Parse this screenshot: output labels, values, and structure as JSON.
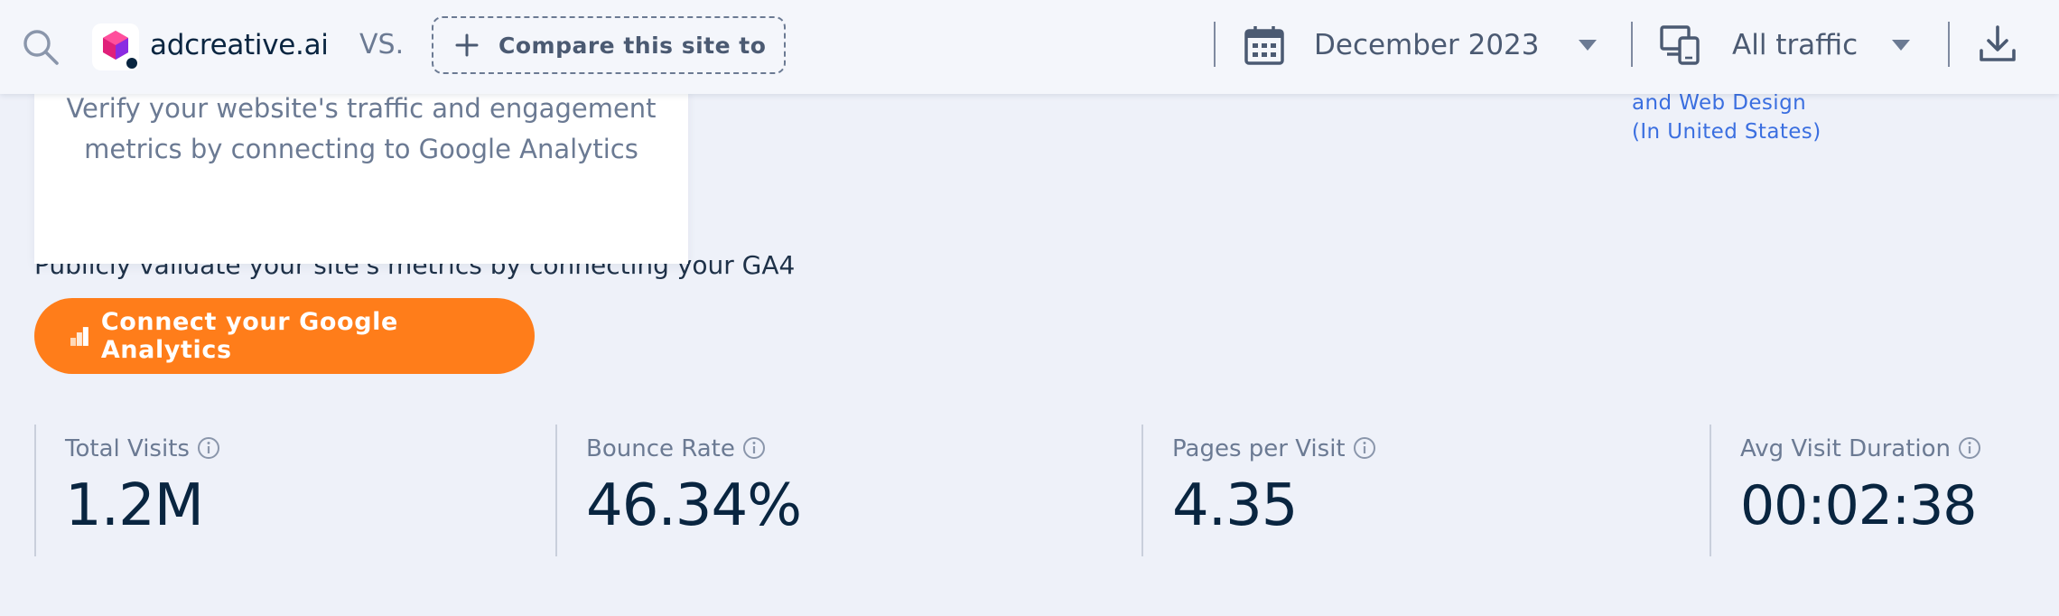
{
  "header": {
    "site_name": "adcreative.ai",
    "vs_label": "VS.",
    "compare_label": "Compare this site to",
    "date_label": "December 2023",
    "traffic_label": "All traffic"
  },
  "verify": {
    "text": "Verify your website's traffic and engagement metrics by connecting to Google Analytics",
    "publicly_text": "Publicly validate your site's metrics by connecting your GA4",
    "connect_label": "Connect your Google Analytics"
  },
  "related": {
    "line1": "and Web Design",
    "line2": "(In United States)"
  },
  "metrics": [
    {
      "label": "Total Visits",
      "value": "1.2M"
    },
    {
      "label": "Bounce Rate",
      "value": "46.34%"
    },
    {
      "label": "Pages per Visit",
      "value": "4.35"
    },
    {
      "label": "Avg Visit Duration",
      "value": "00:02:38"
    }
  ],
  "colors": {
    "accent_orange": "#ff7d1a",
    "navy": "#092540",
    "link_blue": "#3b6fe0",
    "muted": "#6b7a93"
  },
  "icons": [
    "search-icon",
    "site-logo-icon",
    "plus-icon",
    "calendar-icon",
    "chevron-down-icon",
    "devices-icon",
    "download-icon",
    "google-analytics-icon",
    "info-icon"
  ]
}
